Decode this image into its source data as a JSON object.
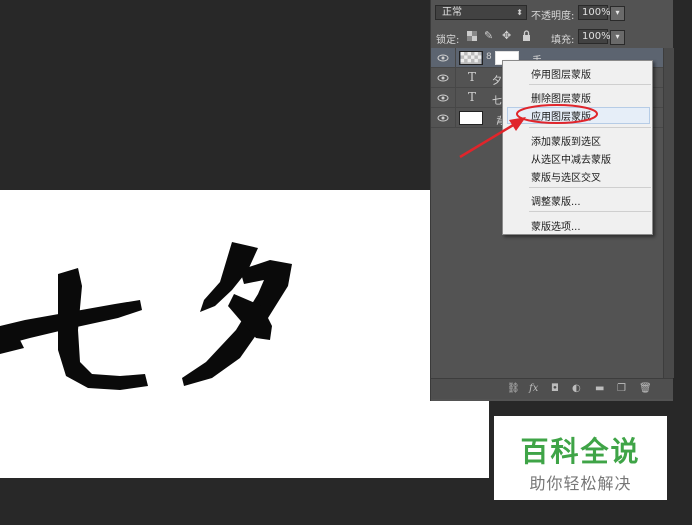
{
  "canvas": {
    "calligraphy_text": "七夕"
  },
  "layers_panel": {
    "blend_mode": "正常",
    "opacity_label": "不透明度:",
    "opacity_value": "100%",
    "lock_label": "锁定:",
    "fill_label": "填充:",
    "fill_value": "100%",
    "layers": [
      {
        "type": "image-with-mask",
        "name": "手"
      },
      {
        "type": "text",
        "name": "夕"
      },
      {
        "type": "text",
        "name": "七"
      },
      {
        "type": "background",
        "name": "背"
      }
    ],
    "text_icon": "T"
  },
  "context_menu": {
    "items": [
      "停用图层蒙版",
      "删除图层蒙版",
      "应用图层蒙版",
      "添加蒙版到选区",
      "从选区中减去蒙版",
      "蒙版与选区交叉",
      "调整蒙版...",
      "蒙版选项..."
    ],
    "highlighted_index": 2
  },
  "annotation": {
    "arrow_color": "#e0252b",
    "circle_color": "#e0252b"
  },
  "watermark": {
    "title": "百科全说",
    "subtitle": "助你轻松解决",
    "title_color": "#3fa447"
  }
}
